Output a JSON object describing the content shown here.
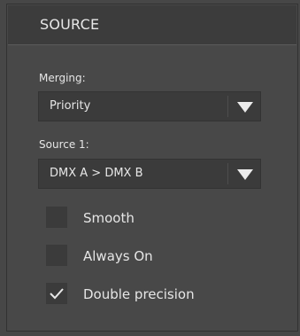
{
  "panel": {
    "title": "SOURCE"
  },
  "merging": {
    "label": "Merging:",
    "selected": "Priority",
    "arrow_icon": "chevron-down-triangle"
  },
  "source1": {
    "label": "Source 1:",
    "selected": "DMX A > DMX B",
    "arrow_icon": "chevron-down-triangle"
  },
  "options": [
    {
      "label": "Smooth",
      "checked": false
    },
    {
      "label": "Always On",
      "checked": false
    },
    {
      "label": "Double precision",
      "checked": true
    }
  ],
  "colors": {
    "background": "#474747",
    "panel_header": "#3c3c3c",
    "control_bg": "#3b3b3b",
    "text": "#e6e6e6"
  }
}
